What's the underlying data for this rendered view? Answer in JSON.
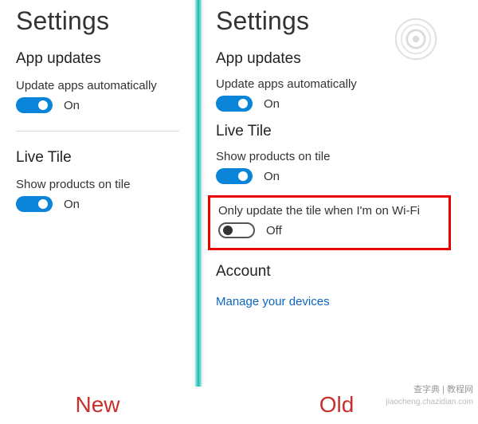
{
  "left": {
    "title": "Settings",
    "sections": {
      "app_updates": {
        "heading": "App updates",
        "update_auto": {
          "label": "Update apps automatically",
          "state": "On",
          "on": true
        }
      },
      "live_tile": {
        "heading": "Live Tile",
        "show_products": {
          "label": "Show products on tile",
          "state": "On",
          "on": true
        }
      }
    }
  },
  "right": {
    "title": "Settings",
    "sections": {
      "app_updates": {
        "heading": "App updates",
        "update_auto": {
          "label": "Update apps automatically",
          "state": "On",
          "on": true
        }
      },
      "live_tile": {
        "heading": "Live Tile",
        "show_products": {
          "label": "Show products on tile",
          "state": "On",
          "on": true
        },
        "wifi_only": {
          "label": "Only update the tile when I'm on Wi-Fi",
          "state": "Off",
          "on": false
        }
      },
      "account": {
        "heading": "Account",
        "manage_link": "Manage your devices"
      }
    }
  },
  "footer": {
    "left_label": "New",
    "right_label": "Old"
  },
  "watermark": {
    "line1": "查字典 | 教程网",
    "line2": "jiaocheng.chazidian.com"
  }
}
